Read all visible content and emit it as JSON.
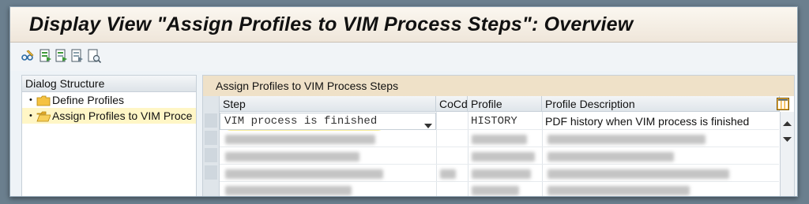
{
  "window": {
    "title": "Display View \"Assign Profiles to VIM Process Steps\": Overview"
  },
  "toolbar": {
    "buttons": [
      {
        "icon": "glasses-pencil-icon"
      },
      {
        "icon": "select-all-icon"
      },
      {
        "icon": "select-block-icon"
      },
      {
        "icon": "deselect-all-icon"
      },
      {
        "icon": "print-preview-icon"
      }
    ]
  },
  "dialog_structure": {
    "title": "Dialog Structure",
    "items": [
      {
        "label": "Define Profiles",
        "selected": false
      },
      {
        "label": "Assign Profiles to VIM Proce",
        "selected": true
      }
    ]
  },
  "table": {
    "title": "Assign Profiles to VIM Process Steps",
    "columns": [
      "Step",
      "CoCd",
      "Profile",
      "Profile Description"
    ],
    "rows": [
      {
        "step": "VIM process is finished",
        "cocd": "",
        "profile": "HISTORY",
        "description": "PDF history when VIM process is finished"
      }
    ]
  },
  "colors": {
    "title_bg": "#fbf7f0",
    "table_title_bg": "#efe1c8",
    "selected_tree_bg": "#fff6c6",
    "highlight": "#f6e878"
  }
}
